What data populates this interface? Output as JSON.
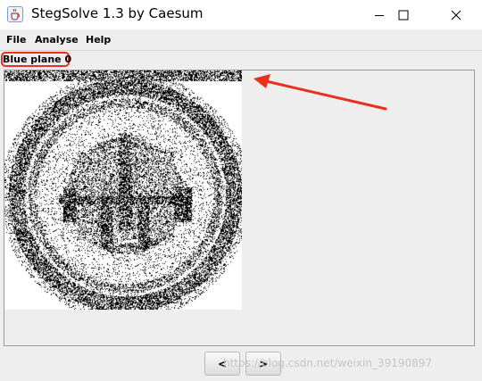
{
  "window": {
    "title": "StegSolve 1.3 by Caesum",
    "app_icon": "java-cup-icon",
    "controls": [
      "minimize-icon",
      "maximize-icon",
      "close-icon"
    ]
  },
  "menubar": {
    "items": [
      {
        "label": "File"
      },
      {
        "label": "Analyse"
      },
      {
        "label": "Help"
      }
    ]
  },
  "viewer": {
    "plane_label": "Blue plane 0",
    "image_content": "bit-plane-noise-image",
    "annotation": {
      "highlight_color": "#e8301c",
      "arrow_color": "#e8301c"
    }
  },
  "navigation": {
    "prev_label": "<",
    "next_label": ">"
  },
  "watermark": {
    "text": "https://blog.csdn.net/weixin_39190897"
  },
  "colors": {
    "window_bg": "#eeeeee",
    "title_bg": "#ffffff",
    "annotation_red": "#e8301c"
  }
}
